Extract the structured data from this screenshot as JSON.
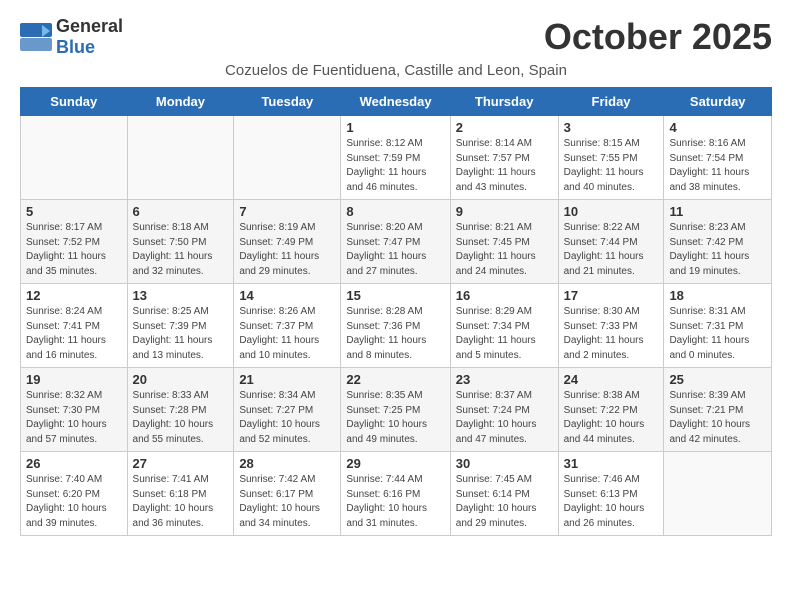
{
  "logo": {
    "general": "General",
    "blue": "Blue",
    "icon": "▶"
  },
  "title": "October 2025",
  "subtitle": "Cozuelos de Fuentiduena, Castille and Leon, Spain",
  "days_of_week": [
    "Sunday",
    "Monday",
    "Tuesday",
    "Wednesday",
    "Thursday",
    "Friday",
    "Saturday"
  ],
  "weeks": [
    [
      {
        "day": "",
        "info": ""
      },
      {
        "day": "",
        "info": ""
      },
      {
        "day": "",
        "info": ""
      },
      {
        "day": "1",
        "info": "Sunrise: 8:12 AM\nSunset: 7:59 PM\nDaylight: 11 hours\nand 46 minutes."
      },
      {
        "day": "2",
        "info": "Sunrise: 8:14 AM\nSunset: 7:57 PM\nDaylight: 11 hours\nand 43 minutes."
      },
      {
        "day": "3",
        "info": "Sunrise: 8:15 AM\nSunset: 7:55 PM\nDaylight: 11 hours\nand 40 minutes."
      },
      {
        "day": "4",
        "info": "Sunrise: 8:16 AM\nSunset: 7:54 PM\nDaylight: 11 hours\nand 38 minutes."
      }
    ],
    [
      {
        "day": "5",
        "info": "Sunrise: 8:17 AM\nSunset: 7:52 PM\nDaylight: 11 hours\nand 35 minutes."
      },
      {
        "day": "6",
        "info": "Sunrise: 8:18 AM\nSunset: 7:50 PM\nDaylight: 11 hours\nand 32 minutes."
      },
      {
        "day": "7",
        "info": "Sunrise: 8:19 AM\nSunset: 7:49 PM\nDaylight: 11 hours\nand 29 minutes."
      },
      {
        "day": "8",
        "info": "Sunrise: 8:20 AM\nSunset: 7:47 PM\nDaylight: 11 hours\nand 27 minutes."
      },
      {
        "day": "9",
        "info": "Sunrise: 8:21 AM\nSunset: 7:45 PM\nDaylight: 11 hours\nand 24 minutes."
      },
      {
        "day": "10",
        "info": "Sunrise: 8:22 AM\nSunset: 7:44 PM\nDaylight: 11 hours\nand 21 minutes."
      },
      {
        "day": "11",
        "info": "Sunrise: 8:23 AM\nSunset: 7:42 PM\nDaylight: 11 hours\nand 19 minutes."
      }
    ],
    [
      {
        "day": "12",
        "info": "Sunrise: 8:24 AM\nSunset: 7:41 PM\nDaylight: 11 hours\nand 16 minutes."
      },
      {
        "day": "13",
        "info": "Sunrise: 8:25 AM\nSunset: 7:39 PM\nDaylight: 11 hours\nand 13 minutes."
      },
      {
        "day": "14",
        "info": "Sunrise: 8:26 AM\nSunset: 7:37 PM\nDaylight: 11 hours\nand 10 minutes."
      },
      {
        "day": "15",
        "info": "Sunrise: 8:28 AM\nSunset: 7:36 PM\nDaylight: 11 hours\nand 8 minutes."
      },
      {
        "day": "16",
        "info": "Sunrise: 8:29 AM\nSunset: 7:34 PM\nDaylight: 11 hours\nand 5 minutes."
      },
      {
        "day": "17",
        "info": "Sunrise: 8:30 AM\nSunset: 7:33 PM\nDaylight: 11 hours\nand 2 minutes."
      },
      {
        "day": "18",
        "info": "Sunrise: 8:31 AM\nSunset: 7:31 PM\nDaylight: 11 hours\nand 0 minutes."
      }
    ],
    [
      {
        "day": "19",
        "info": "Sunrise: 8:32 AM\nSunset: 7:30 PM\nDaylight: 10 hours\nand 57 minutes."
      },
      {
        "day": "20",
        "info": "Sunrise: 8:33 AM\nSunset: 7:28 PM\nDaylight: 10 hours\nand 55 minutes."
      },
      {
        "day": "21",
        "info": "Sunrise: 8:34 AM\nSunset: 7:27 PM\nDaylight: 10 hours\nand 52 minutes."
      },
      {
        "day": "22",
        "info": "Sunrise: 8:35 AM\nSunset: 7:25 PM\nDaylight: 10 hours\nand 49 minutes."
      },
      {
        "day": "23",
        "info": "Sunrise: 8:37 AM\nSunset: 7:24 PM\nDaylight: 10 hours\nand 47 minutes."
      },
      {
        "day": "24",
        "info": "Sunrise: 8:38 AM\nSunset: 7:22 PM\nDaylight: 10 hours\nand 44 minutes."
      },
      {
        "day": "25",
        "info": "Sunrise: 8:39 AM\nSunset: 7:21 PM\nDaylight: 10 hours\nand 42 minutes."
      }
    ],
    [
      {
        "day": "26",
        "info": "Sunrise: 7:40 AM\nSunset: 6:20 PM\nDaylight: 10 hours\nand 39 minutes."
      },
      {
        "day": "27",
        "info": "Sunrise: 7:41 AM\nSunset: 6:18 PM\nDaylight: 10 hours\nand 36 minutes."
      },
      {
        "day": "28",
        "info": "Sunrise: 7:42 AM\nSunset: 6:17 PM\nDaylight: 10 hours\nand 34 minutes."
      },
      {
        "day": "29",
        "info": "Sunrise: 7:44 AM\nSunset: 6:16 PM\nDaylight: 10 hours\nand 31 minutes."
      },
      {
        "day": "30",
        "info": "Sunrise: 7:45 AM\nSunset: 6:14 PM\nDaylight: 10 hours\nand 29 minutes."
      },
      {
        "day": "31",
        "info": "Sunrise: 7:46 AM\nSunset: 6:13 PM\nDaylight: 10 hours\nand 26 minutes."
      },
      {
        "day": "",
        "info": ""
      }
    ]
  ]
}
